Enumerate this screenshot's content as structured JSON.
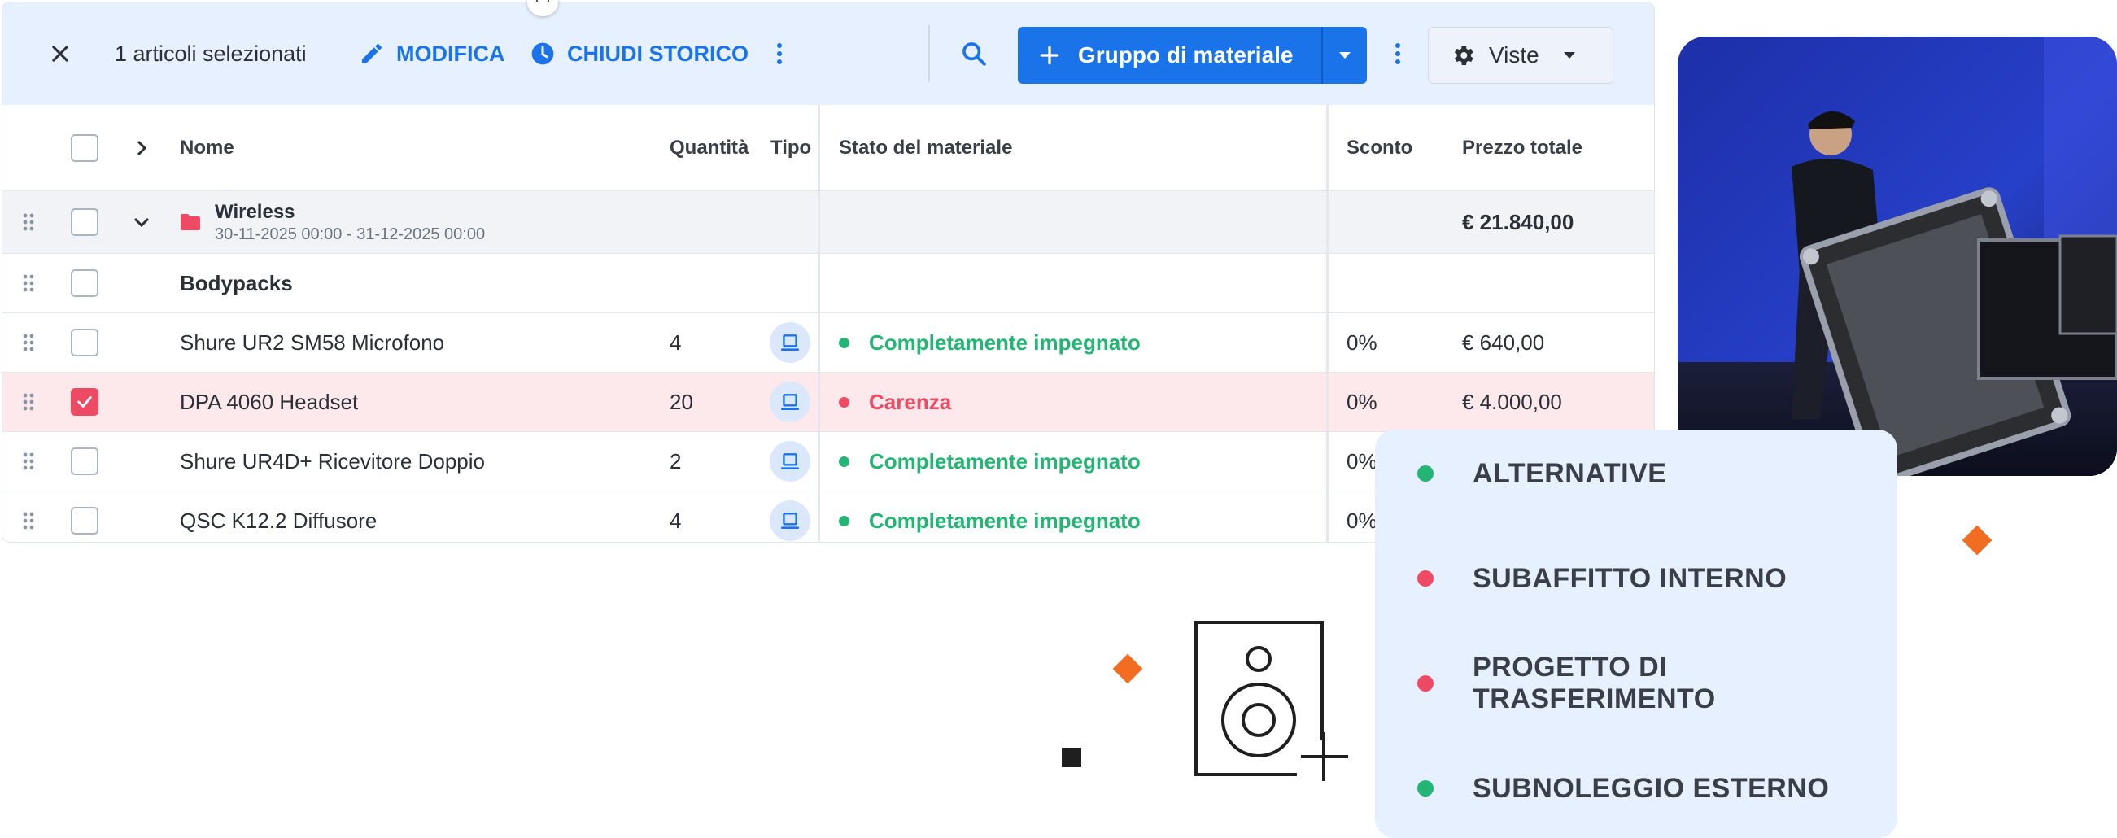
{
  "toolbar": {
    "close_icon": "close-icon",
    "selected_text": "1 articoli selezionati",
    "edit_label": "MODIFICA",
    "history_label": "CHIUDI STORICO",
    "primary_button_label": "Gruppo di materiale",
    "views_label": "Viste"
  },
  "table": {
    "columns": {
      "name": "Nome",
      "quantity": "Quantità (",
      "type": "Tipo",
      "status": "Stato del materiale",
      "discount": "Sconto",
      "total_price": "Prezzo totale"
    },
    "group": {
      "name": "Wireless",
      "date_range": "30-11-2025 00:00 - 31-12-2025 00:00",
      "total": "€ 21.840,00"
    },
    "subgroup": {
      "name": "Bodypacks"
    },
    "rows": [
      {
        "name": "Shure UR2 SM58 Microfono",
        "quantity": "4",
        "status": "Completamente impegnato",
        "discount": "0%",
        "price": "€ 640,00"
      },
      {
        "name": "DPA 4060 Headset",
        "quantity": "20",
        "status": "Carenza",
        "discount": "0%",
        "price": "€ 4.000,00"
      },
      {
        "name": "Shure UR4D+ Ricevitore Doppio",
        "quantity": "2",
        "status": "Completamente impegnato",
        "discount": "0%",
        "price": ""
      },
      {
        "name": "QSC K12.2 Diffusore",
        "quantity": "4",
        "status": "Completamente impegnato",
        "discount": "0%",
        "price": ""
      }
    ]
  },
  "alternatives": [
    {
      "label": "ALTERNATIVE",
      "color": "#22b573"
    },
    {
      "label": "SUBAFFITTO INTERNO",
      "color": "#ef4a63"
    },
    {
      "label": "PROGETTO DI TRASFERIMENTO",
      "color": "#ef4a63"
    },
    {
      "label": "SUBNOLEGGIO ESTERNO",
      "color": "#22b573"
    }
  ],
  "colors": {
    "accent": "#1a73e8",
    "ok": "#22b573",
    "shortage": "#ef4a63",
    "decoration": "#f26d21"
  }
}
